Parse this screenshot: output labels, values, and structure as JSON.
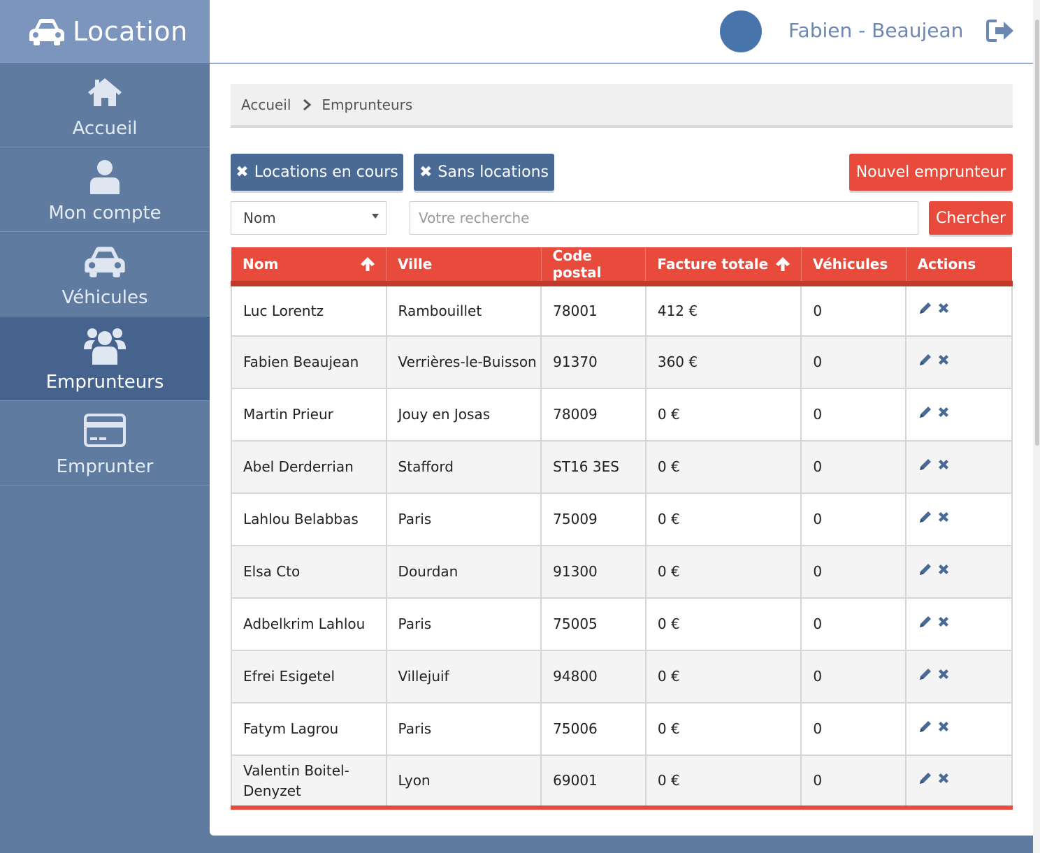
{
  "brand": {
    "title": "Location"
  },
  "user": {
    "name": "Fabien - Beaujean"
  },
  "sidebar": {
    "items": [
      {
        "label": "Accueil",
        "icon": "home-icon"
      },
      {
        "label": "Mon compte",
        "icon": "user-icon"
      },
      {
        "label": "Véhicules",
        "icon": "car-icon"
      },
      {
        "label": "Emprunteurs",
        "icon": "users-icon",
        "active": true
      },
      {
        "label": "Emprunter",
        "icon": "credit-card-icon"
      }
    ]
  },
  "breadcrumb": {
    "home": "Accueil",
    "current": "Emprunteurs"
  },
  "filters": {
    "in_progress_label": "Locations en cours",
    "without_label": "Sans locations",
    "new_label": "Nouvel emprunteur",
    "select_value": "Nom",
    "search_placeholder": "Votre recherche",
    "search_button": "Chercher"
  },
  "table": {
    "columns": [
      "Nom",
      "Ville",
      "Code postal",
      "Facture totale",
      "Véhicules",
      "Actions"
    ],
    "rows": [
      {
        "nom": "Luc Lorentz",
        "ville": "Rambouillet",
        "cp": "78001",
        "facture": "412 €",
        "vehicules": "0"
      },
      {
        "nom": "Fabien Beaujean",
        "ville": "Verrières-le-Buisson",
        "cp": "91370",
        "facture": "360 €",
        "vehicules": "0"
      },
      {
        "nom": "Martin Prieur",
        "ville": "Jouy en Josas",
        "cp": "78009",
        "facture": "0 €",
        "vehicules": "0"
      },
      {
        "nom": "Abel Derderrian",
        "ville": "Stafford",
        "cp": "ST16 3ES",
        "facture": "0 €",
        "vehicules": "0"
      },
      {
        "nom": "Lahlou Belabbas",
        "ville": "Paris",
        "cp": "75009",
        "facture": "0 €",
        "vehicules": "0"
      },
      {
        "nom": "Elsa Cto",
        "ville": "Dourdan",
        "cp": "91300",
        "facture": "0 €",
        "vehicules": "0"
      },
      {
        "nom": "Adbelkrim Lahlou",
        "ville": "Paris",
        "cp": "75005",
        "facture": "0 €",
        "vehicules": "0"
      },
      {
        "nom": "Efrei Esigetel",
        "ville": "Villejuif",
        "cp": "94800",
        "facture": "0 €",
        "vehicules": "0"
      },
      {
        "nom": "Fatym Lagrou",
        "ville": "Paris",
        "cp": "75006",
        "facture": "0 €",
        "vehicules": "0"
      },
      {
        "nom": "Valentin Boitel-Denyzet",
        "ville": "Lyon",
        "cp": "69001",
        "facture": "0 €",
        "vehicules": "0"
      }
    ]
  },
  "colors": {
    "accent_red": "#e84b3c",
    "sidebar": "#5f7ba0",
    "button_blue": "#4a6a96"
  }
}
